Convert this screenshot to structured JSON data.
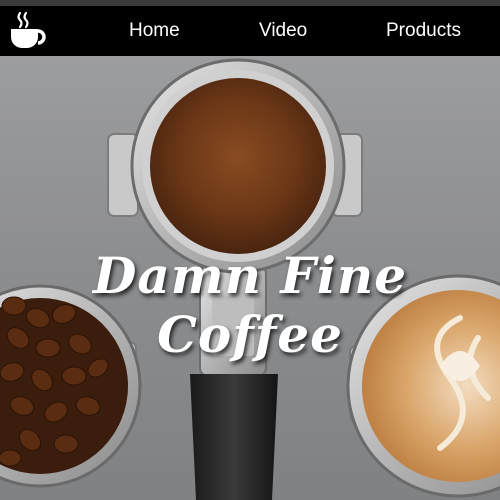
{
  "nav": {
    "logo_icon": "coffee-cup-icon",
    "items": [
      {
        "label": "Home"
      },
      {
        "label": "Video"
      },
      {
        "label": "Products"
      }
    ]
  },
  "hero": {
    "title": "Damn Fine Coffee",
    "image_description_icon": "coffee-portafilters-image"
  },
  "colors": {
    "navbar_bg": "#000000",
    "nav_text": "#ffffff",
    "title_text": "#ffffff"
  }
}
